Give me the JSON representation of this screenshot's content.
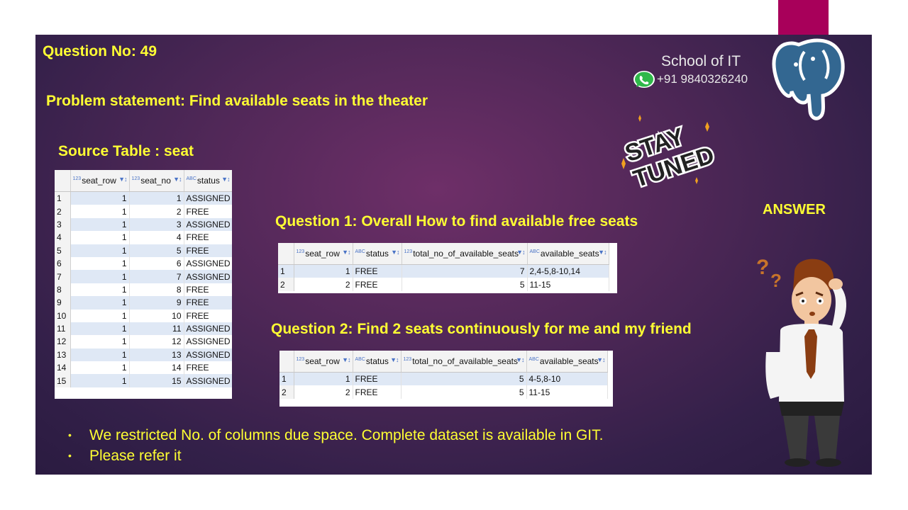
{
  "slide": {
    "question_no": "Question No: 49",
    "problem": "Problem statement: Find available seats in the theater",
    "source_title": "Source Table : seat",
    "q1_title": "Question 1: Overall How to find available free seats",
    "q2_title": "Question 2: Find 2 seats continuously for me and my friend",
    "answer_label": "ANSWER",
    "brand": "School of IT",
    "phone": "+91 9840326240",
    "bullets": [
      "We restricted No. of columns due space. Complete dataset is available in GIT.",
      "Please refer it"
    ],
    "images": {
      "whatsapp": "whatsapp-icon",
      "logo": "postgresql-elephant-logo",
      "sticker": "stay-tuned-sticker",
      "person": "confused-man-illustration"
    },
    "colors": {
      "title_text": "#ffff33",
      "accent_bar": "#a8005a",
      "background": "#512858"
    }
  },
  "source_table": {
    "type_badges": [
      "123",
      "123",
      "ABC"
    ],
    "columns": [
      "seat_row",
      "seat_no",
      "status"
    ],
    "rows": [
      [
        "1",
        "1",
        "1",
        "ASSIGNED"
      ],
      [
        "2",
        "1",
        "2",
        "FREE"
      ],
      [
        "3",
        "1",
        "3",
        "ASSIGNED"
      ],
      [
        "4",
        "1",
        "4",
        "FREE"
      ],
      [
        "5",
        "1",
        "5",
        "FREE"
      ],
      [
        "6",
        "1",
        "6",
        "ASSIGNED"
      ],
      [
        "7",
        "1",
        "7",
        "ASSIGNED"
      ],
      [
        "8",
        "1",
        "8",
        "FREE"
      ],
      [
        "9",
        "1",
        "9",
        "FREE"
      ],
      [
        "10",
        "1",
        "10",
        "FREE"
      ],
      [
        "11",
        "1",
        "11",
        "ASSIGNED"
      ],
      [
        "12",
        "1",
        "12",
        "ASSIGNED"
      ],
      [
        "13",
        "1",
        "13",
        "ASSIGNED"
      ],
      [
        "14",
        "1",
        "14",
        "FREE"
      ],
      [
        "15",
        "1",
        "15",
        "ASSIGNED"
      ]
    ]
  },
  "q1_table": {
    "type_badges": [
      "123",
      "ABC",
      "123",
      "ABC"
    ],
    "columns": [
      "seat_row",
      "status",
      "total_no_of_available_seats",
      "available_seats"
    ],
    "rows": [
      [
        "1",
        "1",
        "FREE",
        "7",
        "2,4-5,8-10,14"
      ],
      [
        "2",
        "2",
        "FREE",
        "5",
        "11-15"
      ]
    ]
  },
  "q2_table": {
    "type_badges": [
      "123",
      "ABC",
      "123",
      "ABC"
    ],
    "columns": [
      "seat_row",
      "status",
      "total_no_of_available_seats",
      "available_seats"
    ],
    "rows": [
      [
        "1",
        "1",
        "FREE",
        "5",
        "4-5,8-10"
      ],
      [
        "2",
        "2",
        "FREE",
        "5",
        "11-15"
      ]
    ]
  }
}
